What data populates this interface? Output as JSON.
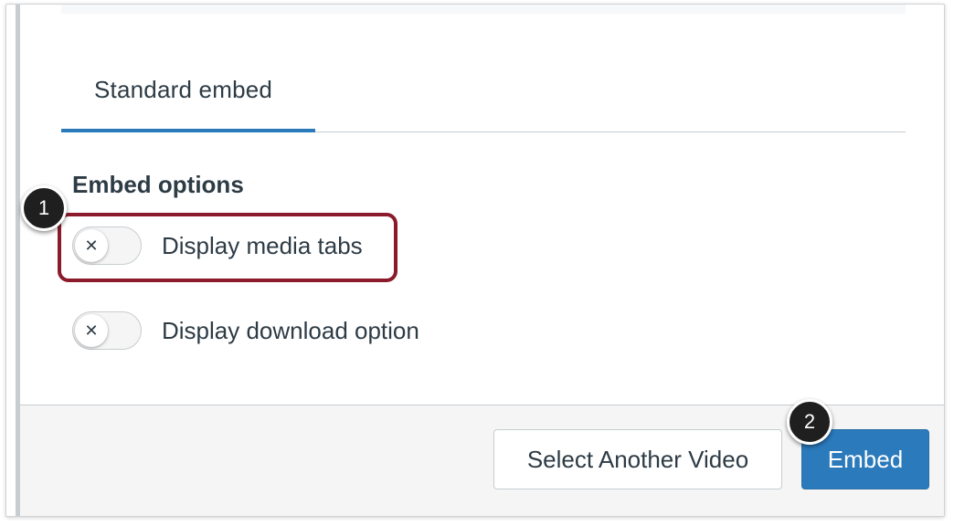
{
  "tabs": [
    {
      "label": "Standard embed",
      "selected": true
    }
  ],
  "embed_options": {
    "title": "Embed options",
    "options": [
      {
        "label": "Display media tabs",
        "enabled": false,
        "toggle_icon": "x-icon"
      },
      {
        "label": "Display download option",
        "enabled": false,
        "toggle_icon": "x-icon"
      }
    ]
  },
  "callouts": [
    "1",
    "2"
  ],
  "footer": {
    "select_another_label": "Select Another Video",
    "embed_label": "Embed"
  },
  "colors": {
    "primary": "#2b7abc",
    "highlight": "#8b1a2b",
    "text": "#2d3b45"
  }
}
